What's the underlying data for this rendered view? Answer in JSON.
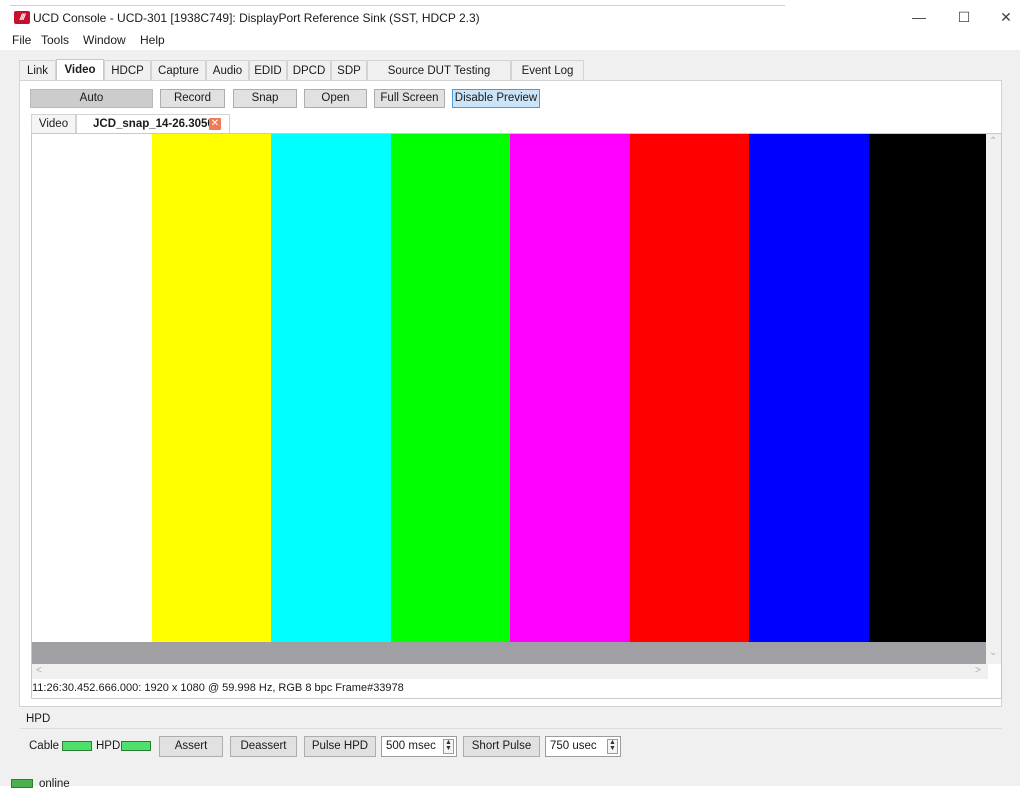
{
  "window": {
    "logo_text": "///",
    "title": "UCD Console - UCD-301 [1938C749]: DisplayPort Reference Sink (SST, HDCP 2.3)",
    "minimize": "—",
    "maximize": "☐",
    "close": "✕"
  },
  "menu": {
    "file": "File",
    "tools": "Tools",
    "window": "Window",
    "help": "Help"
  },
  "tabs": [
    "Link",
    "Video",
    "HDCP",
    "Capture",
    "Audio",
    "EDID",
    "DPCD",
    "SDP",
    "Source DUT Testing",
    "Event Log"
  ],
  "active_tab": "Video",
  "toolbar": {
    "auto": "Auto",
    "record": "Record",
    "snap": "Snap",
    "open": "Open",
    "full_screen": "Full Screen",
    "disable_preview": "Disable Preview"
  },
  "subtabs": {
    "video": "Video",
    "snap": "JCD_snap_14-26.30504",
    "close": "✕"
  },
  "color_bars": [
    "#ffffff",
    "#ffff00",
    "#00ffff",
    "#00ff00",
    "#ff00ff",
    "#ff0000",
    "#0000ff",
    "#000000"
  ],
  "status": "11:26:30.452.666.000: 1920 x 1080 @ 59.998 Hz, RGB 8 bpc Frame#33978",
  "hpd": {
    "group_label": "HPD",
    "cable_label": "Cable",
    "hpd_label": "HPD",
    "assert": "Assert",
    "deassert": "Deassert",
    "pulse_hpd": "Pulse HPD",
    "pulse_value": "500 msec",
    "short_pulse": "Short Pulse",
    "short_value": "750 usec"
  },
  "statusbar": {
    "online": "online"
  }
}
